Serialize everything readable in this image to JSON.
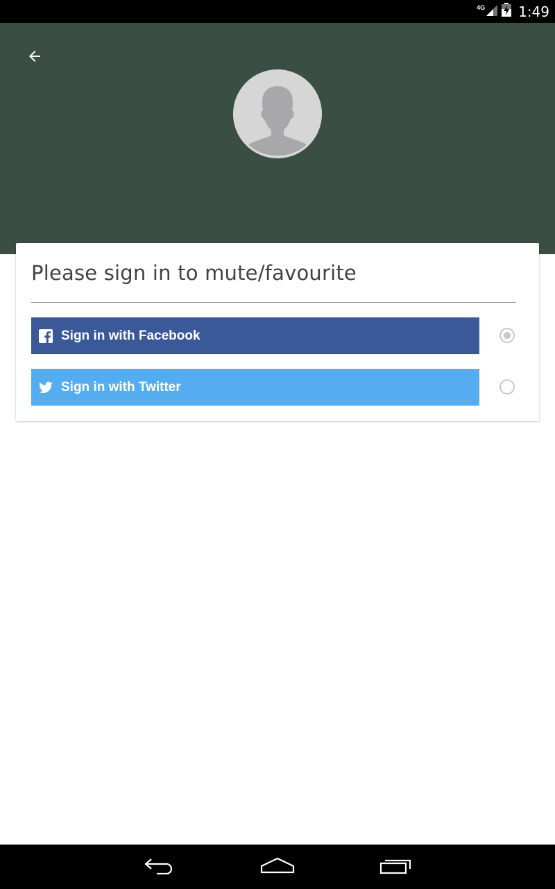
{
  "status_bar": {
    "network": "4G",
    "time": "1:49"
  },
  "header": {
    "background": "#3b4e43",
    "back_icon": "arrow-left-icon",
    "avatar_icon": "person-placeholder-icon"
  },
  "card": {
    "title": "Please sign in to mute/favourite",
    "options": [
      {
        "label": "Sign in with Facebook",
        "icon": "facebook-icon",
        "color": "#3b5998",
        "selected": true
      },
      {
        "label": "Sign in with Twitter",
        "icon": "twitter-icon",
        "color": "#55acee",
        "selected": false
      }
    ]
  },
  "nav_bar": {
    "buttons": [
      "back-icon",
      "home-icon",
      "recent-apps-icon"
    ]
  }
}
